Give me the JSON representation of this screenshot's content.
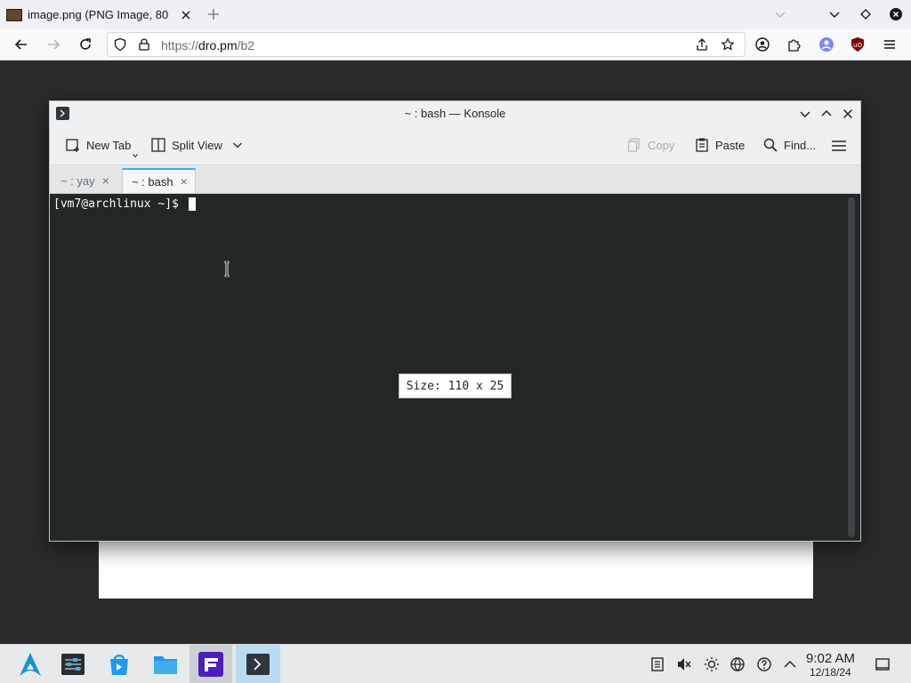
{
  "browser": {
    "tab_title": "image.png (PNG Image, 80",
    "url_prefix": "https://",
    "url_host": "dro.pm",
    "url_path": "/b2"
  },
  "konsole": {
    "window_title": "~ : bash — Konsole",
    "toolbar": {
      "new_tab": "New Tab",
      "split_view": "Split View",
      "copy": "Copy",
      "paste": "Paste",
      "find": "Find..."
    },
    "tabs": [
      {
        "label": "~ : yay",
        "active": false
      },
      {
        "label": "~ : bash",
        "active": true
      }
    ],
    "terminal": {
      "prompt": "[vm7@archlinux ~]$ "
    },
    "size_popup": "Size: 110 x 25"
  },
  "taskbar": {
    "clock_time": "9:02 AM",
    "clock_date": "12/18/24",
    "launchers": [
      "application-launcher-icon",
      "system-settings-icon",
      "discover-icon",
      "dolphin-icon",
      "foot-terminal-icon",
      "konsole-icon"
    ]
  },
  "colors": {
    "terminal_bg": "#232627",
    "accent": "#3daee9",
    "taskbar_active": "#b9dcf2"
  }
}
